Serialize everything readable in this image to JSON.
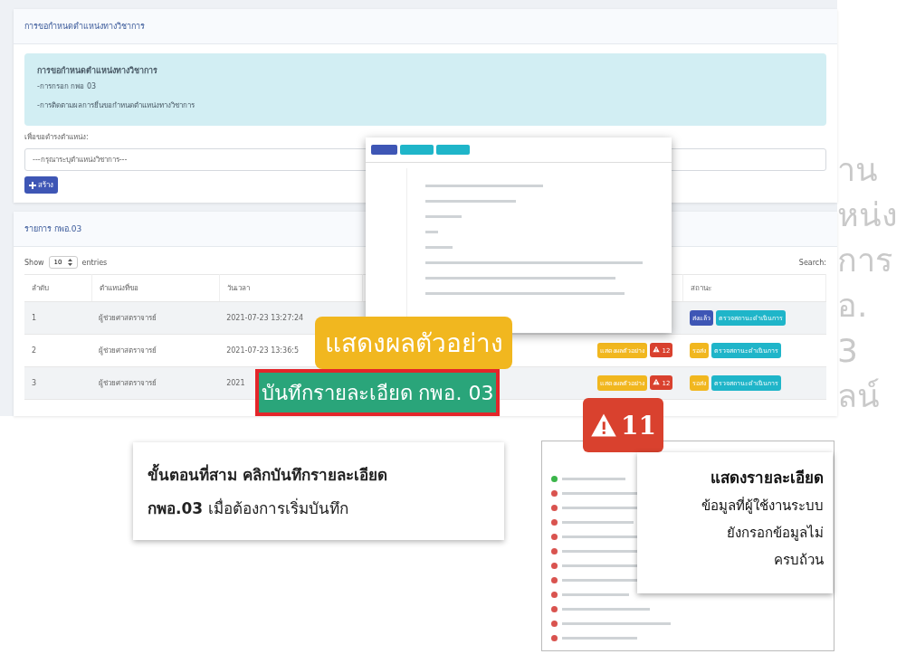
{
  "request_card": {
    "title": "การขอกำหนดตำแหน่งทางวิชาการ",
    "info": {
      "heading": "การขอกำหนดตำแหน่งทางวิชาการ",
      "lines": [
        "-การกรอก กพอ 03",
        "-การติดตามผลการยื่นขอกำหนดตำแหน่งทางวิชาการ"
      ]
    },
    "position_label": "เพื่อขอดำรงตำแหน่ง:",
    "position_select": {
      "placeholder": "---กรุณาระบุตำแหน่งวิชาการ---"
    },
    "create_button": "สร้าง"
  },
  "list_card": {
    "title": "รายการ กพอ.03",
    "show_label": "Show",
    "page_size": "10",
    "entries_label": "entries",
    "search_label": "Search:",
    "columns": [
      "ลำดับ",
      "ตำแหน่งที่ขอ",
      "วันเวลา",
      "",
      "สถานะ"
    ],
    "rows": [
      {
        "no": "1",
        "position": "ผู้ช่วยศาสตราจารย์",
        "datetime": "2021-07-23 13:27:24",
        "actions": [],
        "status": {
          "label": "ส่งแล้ว",
          "kind": "sent"
        },
        "check_label": "ตรวจสถานะดำเนินการ"
      },
      {
        "no": "2",
        "position": "ผู้ช่วยศาสตราจารย์",
        "datetime": "2021-07-23 13:36:5",
        "actions": [
          {
            "kind": "preview",
            "label": "แสดงผลตัวอย่าง"
          },
          {
            "kind": "warning",
            "label": "12"
          }
        ],
        "status": {
          "label": "รอส่ง",
          "kind": "pending"
        },
        "check_label": "ตรวจสถานะดำเนินการ"
      },
      {
        "no": "3",
        "position": "ผู้ช่วยศาสตราจารย์",
        "datetime": "2021",
        "actions": [
          {
            "kind": "preview",
            "label": "แสดงผลตัวอย่าง"
          },
          {
            "kind": "warning",
            "label": "12"
          }
        ],
        "status": {
          "label": "รอส่ง",
          "kind": "pending"
        },
        "check_label": "ตรวจสถานะดำเนินการ"
      }
    ]
  },
  "side_words": [
    "าน",
    "หน่ง",
    "การ",
    "อ.",
    "3",
    "ลน์"
  ],
  "callouts": {
    "preview": "แสดงผลตัวอย่าง",
    "record": "บันทึกรายละเอียด กพอ. 03",
    "warning_count": "11"
  },
  "step_note": "**ขั้นตอนที่สาม คลิกบันทึกรายละเอียด**\n**กพอ.03** เมื่อต้องการเริ่มบันทึก",
  "checklist": [
    {
      "ok": true
    },
    {
      "ok": false
    },
    {
      "ok": false
    },
    {
      "ok": false
    },
    {
      "ok": false
    },
    {
      "ok": false
    },
    {
      "ok": false
    },
    {
      "ok": false
    },
    {
      "ok": false
    },
    {
      "ok": false
    },
    {
      "ok": false
    },
    {
      "ok": false
    }
  ],
  "detail_note": {
    "title": "แสดงรายละเอียด",
    "lines": [
      "ข้อมูลที่ผู้ใช้งานระบบ",
      "ยังกรอกข้อมูลไม่",
      "ครบถ้วน"
    ]
  }
}
